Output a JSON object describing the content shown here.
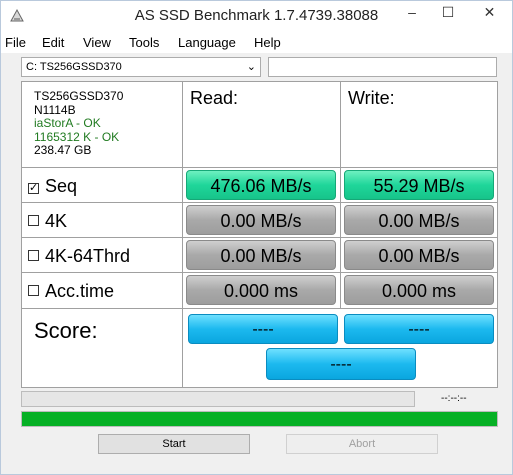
{
  "window": {
    "title": "AS SSD Benchmark 1.7.4739.38088",
    "minimize": "–",
    "maximize": "☐",
    "close": "✕"
  },
  "menu": [
    "File",
    "Edit",
    "View",
    "Tools",
    "Language",
    "Help"
  ],
  "drive": {
    "selected": "C: TS256GSSD370"
  },
  "info": {
    "model": "TS256GSSD370",
    "firmware": "N1114B",
    "driver": "iaStorA - OK",
    "alignment": "1165312 K - OK",
    "size": "238.47 GB"
  },
  "columns": {
    "read": "Read:",
    "write": "Write:"
  },
  "rows": [
    {
      "label": "Seq",
      "checked": true,
      "read": "476.06 MB/s",
      "write": "55.29 MB/s"
    },
    {
      "label": "4K",
      "checked": false,
      "read": "0.00 MB/s",
      "write": "0.00 MB/s"
    },
    {
      "label": "4K-64Thrd",
      "checked": false,
      "read": "0.00 MB/s",
      "write": "0.00 MB/s"
    },
    {
      "label": "Acc.time",
      "checked": false,
      "read": "0.000 ms",
      "write": "0.000 ms"
    }
  ],
  "score": {
    "label": "Score:",
    "read": "----",
    "write": "----",
    "total": "----"
  },
  "progress": {
    "time": "--:--:--",
    "total_fraction": 1.0
  },
  "buttons": {
    "start": "Start",
    "abort": "Abort"
  },
  "colors": {
    "result_active": "#1fd69a",
    "result_idle": "#a9a9a9",
    "score": "#1cb9ef",
    "progress": "#06b025"
  },
  "checkmark": "✓"
}
